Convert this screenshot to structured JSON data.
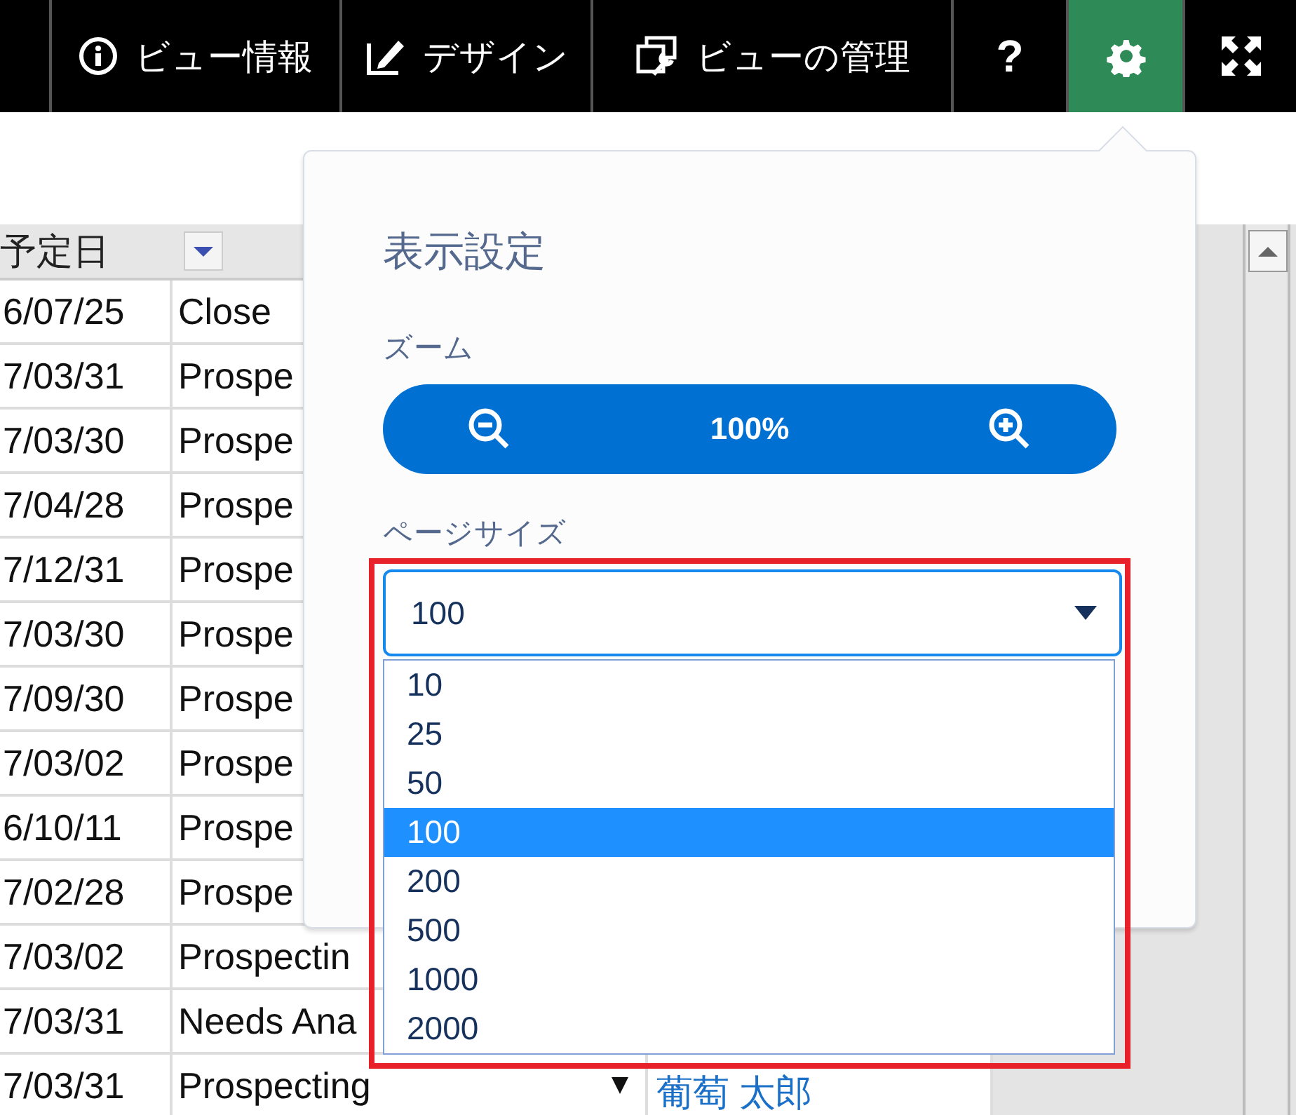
{
  "toolbar": {
    "items": [
      {
        "kind": "info",
        "label": "ビュー情報",
        "selected": false
      },
      {
        "kind": "design",
        "label": "デザイン",
        "selected": false
      },
      {
        "kind": "manage",
        "label": "ビューの管理",
        "selected": false
      },
      {
        "kind": "help",
        "label": "?",
        "selected": false
      },
      {
        "kind": "settings",
        "selected": true
      },
      {
        "kind": "fullscreen",
        "selected": false
      }
    ]
  },
  "table": {
    "columns": [
      {
        "label": "予定日"
      }
    ],
    "rows": [
      {
        "date": "6/07/25",
        "stage": "Close"
      },
      {
        "date": "7/03/31",
        "stage": "Prospe"
      },
      {
        "date": "7/03/30",
        "stage": "Prospe"
      },
      {
        "date": "7/04/28",
        "stage": "Prospe"
      },
      {
        "date": "7/12/31",
        "stage": "Prospe"
      },
      {
        "date": "7/03/30",
        "stage": "Prospe"
      },
      {
        "date": "7/09/30",
        "stage": "Prospe"
      },
      {
        "date": "7/03/02",
        "stage": "Prospe"
      },
      {
        "date": "6/10/11",
        "stage": "Prospe"
      },
      {
        "date": "7/02/28",
        "stage": "Prospe"
      },
      {
        "date": "7/03/02",
        "stage": "Prospectin"
      },
      {
        "date": "7/03/31",
        "stage": "Needs Ana"
      },
      {
        "date": "7/03/31",
        "stage": "Prospecting",
        "caret": true,
        "owner": "葡萄 太郎"
      }
    ]
  },
  "settings_panel": {
    "title": "表示設定",
    "zoom": {
      "label": "ズーム",
      "value": "100%"
    },
    "page_size": {
      "label": "ページサイズ",
      "value": "100",
      "expanded": true,
      "options": [
        {
          "label": "10",
          "selected": false
        },
        {
          "label": "25",
          "selected": false
        },
        {
          "label": "50",
          "selected": false
        },
        {
          "label": "100",
          "selected": true
        },
        {
          "label": "200",
          "selected": false
        },
        {
          "label": "500",
          "selected": false
        },
        {
          "label": "1000",
          "selected": false
        },
        {
          "label": "2000",
          "selected": false
        }
      ]
    }
  }
}
